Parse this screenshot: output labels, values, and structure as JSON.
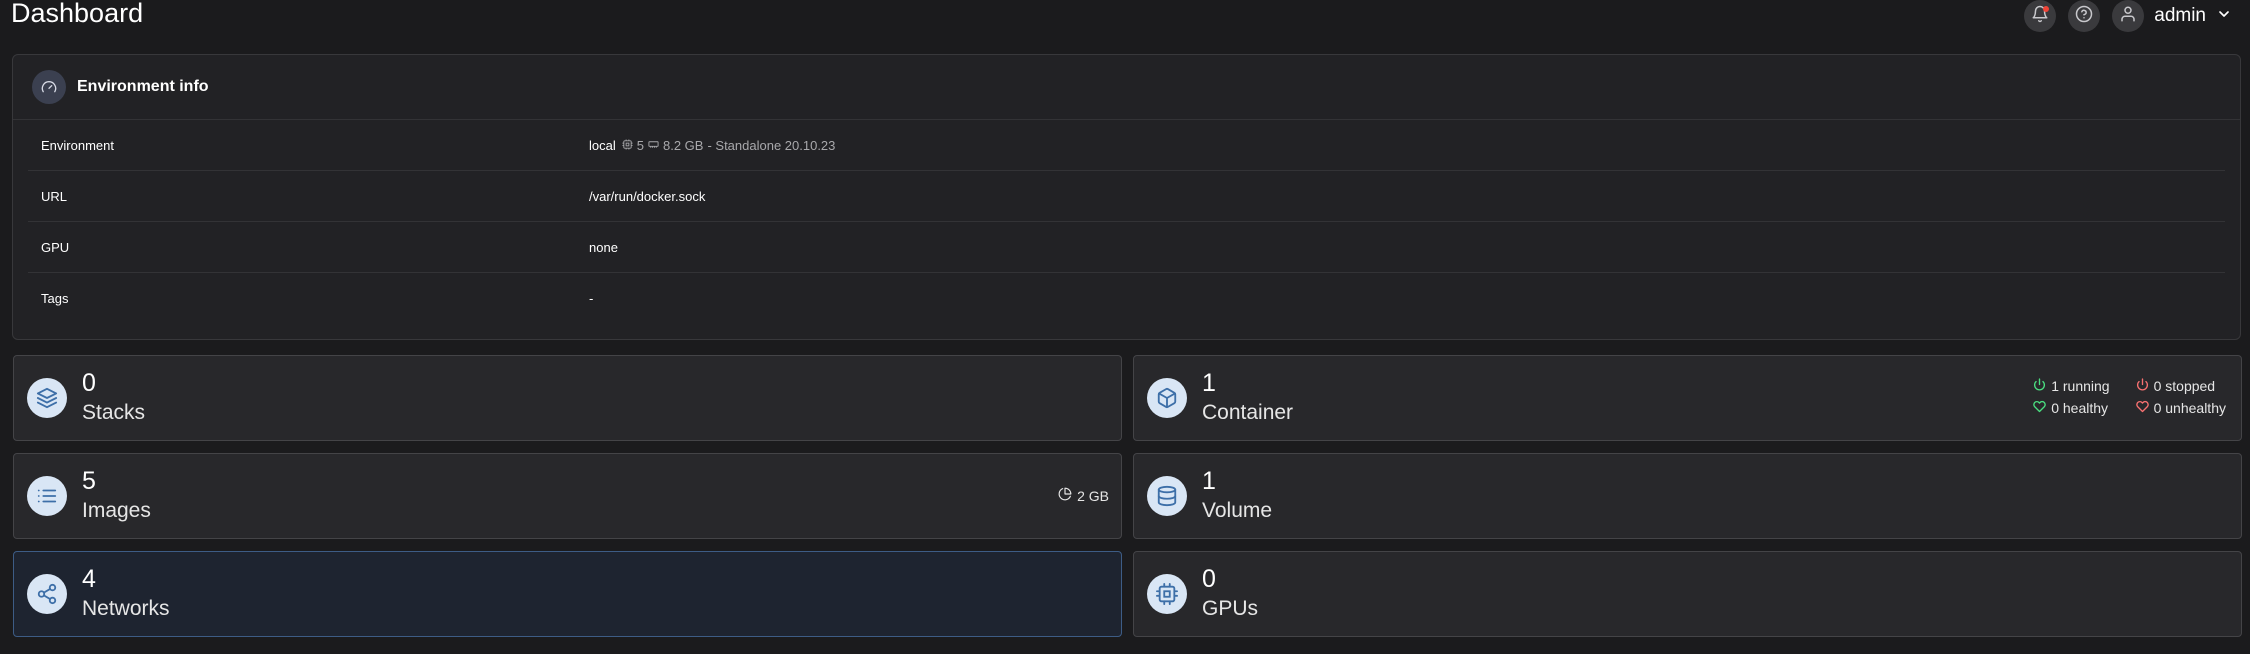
{
  "header": {
    "title": "Dashboard",
    "username": "admin"
  },
  "environment_info": {
    "title": "Environment info",
    "rows": [
      {
        "label": "Environment",
        "value": "local",
        "cpu": "5",
        "memory": "8.2 GB",
        "mode": "- Standalone 20.10.23"
      },
      {
        "label": "URL",
        "value": "/var/run/docker.sock"
      },
      {
        "label": "GPU",
        "value": "none"
      },
      {
        "label": "Tags",
        "value": "-"
      }
    ]
  },
  "tiles": {
    "stacks": {
      "count": "0",
      "label": "Stacks",
      "icon": "layers-icon"
    },
    "containers": {
      "count": "1",
      "label": "Container",
      "icon": "box-icon",
      "running": "1 running",
      "stopped": "0 stopped",
      "healthy": "0 healthy",
      "unhealthy": "0 unhealthy"
    },
    "images": {
      "count": "5",
      "label": "Images",
      "icon": "list-icon",
      "size": "2 GB"
    },
    "volumes": {
      "count": "1",
      "label": "Volume",
      "icon": "database-icon"
    },
    "networks": {
      "count": "4",
      "label": "Networks",
      "icon": "share-icon"
    },
    "gpus": {
      "count": "0",
      "label": "GPUs",
      "icon": "cpu-icon"
    }
  },
  "colors": {
    "running": "#4ade80",
    "stopped": "#f87171",
    "healthy": "#4ade80",
    "unhealthy": "#f87171",
    "icon_bg": "#d9e6f5",
    "icon_fg": "#3d6fa8"
  }
}
